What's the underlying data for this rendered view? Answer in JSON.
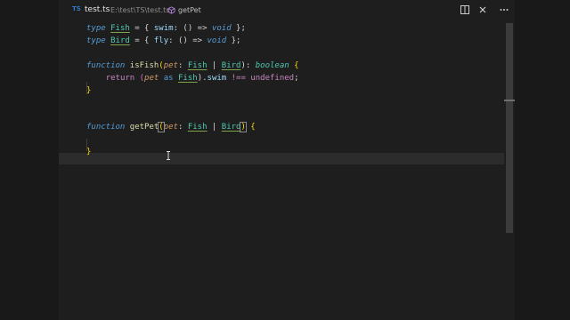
{
  "tab": {
    "lang_badge": "TS",
    "filename": "test.ts",
    "path": "E:\\test\\TS\\test.ts",
    "symbol": "getPet"
  },
  "actions": {
    "split_icon": "split-editor-icon",
    "close_icon": "close-icon",
    "more_icon": "more-actions-icon"
  },
  "code": {
    "l1": {
      "t1": "type",
      "t2": "Fish",
      "t3": " = { ",
      "t4": "swim",
      "t5": ": () => ",
      "t6": "void",
      "t7": " };"
    },
    "l2": {
      "t1": "type",
      "t2": "Bird",
      "t3": " = { ",
      "t4": "fly",
      "t5": ": () => ",
      "t6": "void",
      "t7": " };"
    },
    "l3": {
      "t1": "function",
      "t2": "isFish",
      "t3": "(",
      "t4": "pet",
      "t5": ": ",
      "t6": "Fish",
      "t7": " | ",
      "t8": "Bird",
      "t9": "): ",
      "t10": "boolean",
      "t11": " {"
    },
    "l4": {
      "t1": "return",
      "t2": "(",
      "t3": "pet",
      "t4": " as ",
      "t5": "Fish",
      "t6": ").",
      "t7": "swim",
      "t8": " !== ",
      "t9": "undefined",
      "t10": ";"
    },
    "l5": {
      "t1": "}"
    },
    "l6": {
      "t1": "function",
      "t2": "getPet",
      "t3": "(",
      "t4": "pet",
      "t5": ": ",
      "t6": "Fish",
      "t7": " | ",
      "t8": "Bird",
      "t9": ")",
      "t10": " {"
    },
    "l7": {
      "t1": "}"
    }
  }
}
